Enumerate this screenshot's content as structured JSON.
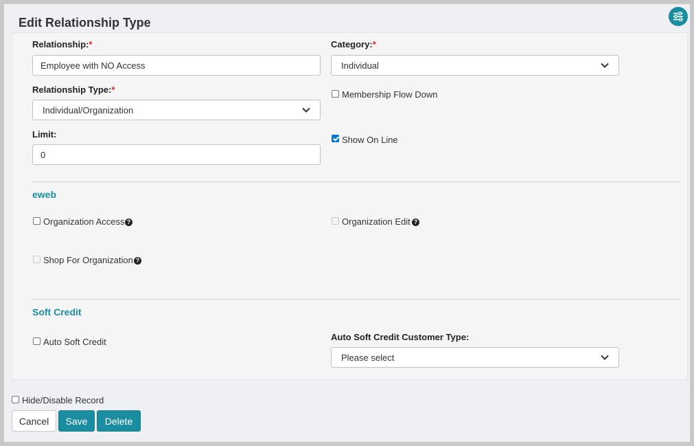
{
  "page": {
    "title": "Edit Relationship Type"
  },
  "header": {
    "settings_icon": "sliders-icon",
    "accent_color": "#1a8ea0"
  },
  "form": {
    "relationship": {
      "label": "Relationship:",
      "required_mark": "*",
      "value": "Employee with NO Access"
    },
    "category": {
      "label": "Category:",
      "required_mark": "*",
      "selected": "Individual"
    },
    "relationship_type": {
      "label": "Relationship Type:",
      "required_mark": "*",
      "selected": "Individual/Organization"
    },
    "membership_flow_down": {
      "label": "Membership Flow Down",
      "checked": false
    },
    "limit": {
      "label": "Limit:",
      "value": "0"
    },
    "show_on_line": {
      "label": "Show On Line",
      "checked": true
    }
  },
  "eweb": {
    "title": "eweb",
    "organization_access": {
      "label": "Organization Access",
      "checked": false,
      "help": "?"
    },
    "organization_edit": {
      "label": "Organization Edit",
      "checked": false,
      "disabled": true,
      "help": "?"
    },
    "shop_for_organization": {
      "label": "Shop For Organization",
      "checked": false,
      "disabled": true,
      "help": "?"
    }
  },
  "soft_credit": {
    "title": "Soft Credit",
    "auto_soft_credit": {
      "label": "Auto Soft Credit",
      "checked": false
    },
    "customer_type": {
      "label": "Auto Soft Credit Customer Type:",
      "selected": "Please select"
    }
  },
  "footer": {
    "hide_disable": {
      "label": "Hide/Disable Record",
      "checked": false
    },
    "cancel_label": "Cancel",
    "save_label": "Save",
    "delete_label": "Delete"
  }
}
